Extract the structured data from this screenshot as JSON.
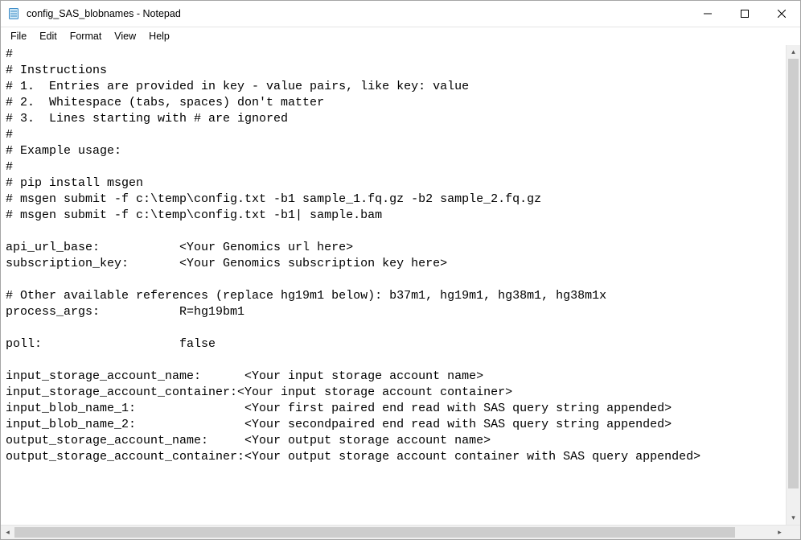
{
  "window": {
    "title": "config_SAS_blobnames - Notepad"
  },
  "menu": {
    "file": "File",
    "edit": "Edit",
    "format": "Format",
    "view": "View",
    "help": "Help"
  },
  "document": {
    "lines": [
      "#",
      "# Instructions",
      "# 1.  Entries are provided in key - value pairs, like key: value",
      "# 2.  Whitespace (tabs, spaces) don't matter",
      "# 3.  Lines starting with # are ignored",
      "#",
      "# Example usage:",
      "#",
      "# pip install msgen",
      "# msgen submit -f c:\\temp\\config.txt -b1 sample_1.fq.gz -b2 sample_2.fq.gz",
      "# msgen submit -f c:\\temp\\config.txt -b1| sample.bam",
      "",
      "api_url_base:           <Your Genomics url here>",
      "subscription_key:       <Your Genomics subscription key here>",
      "",
      "# Other available references (replace hg19m1 below): b37m1, hg19m1, hg38m1, hg38m1x",
      "process_args:           R=hg19bm1",
      "",
      "poll:                   false",
      "",
      "input_storage_account_name:      <Your input storage account name>",
      "input_storage_account_container:<Your input storage account container>",
      "input_blob_name_1:               <Your first paired end read with SAS query string appended>",
      "input_blob_name_2:               <Your secondpaired end read with SAS query string appended>",
      "output_storage_account_name:     <Your output storage account name>",
      "output_storage_account_container:<Your output storage account container with SAS query appended>"
    ]
  }
}
